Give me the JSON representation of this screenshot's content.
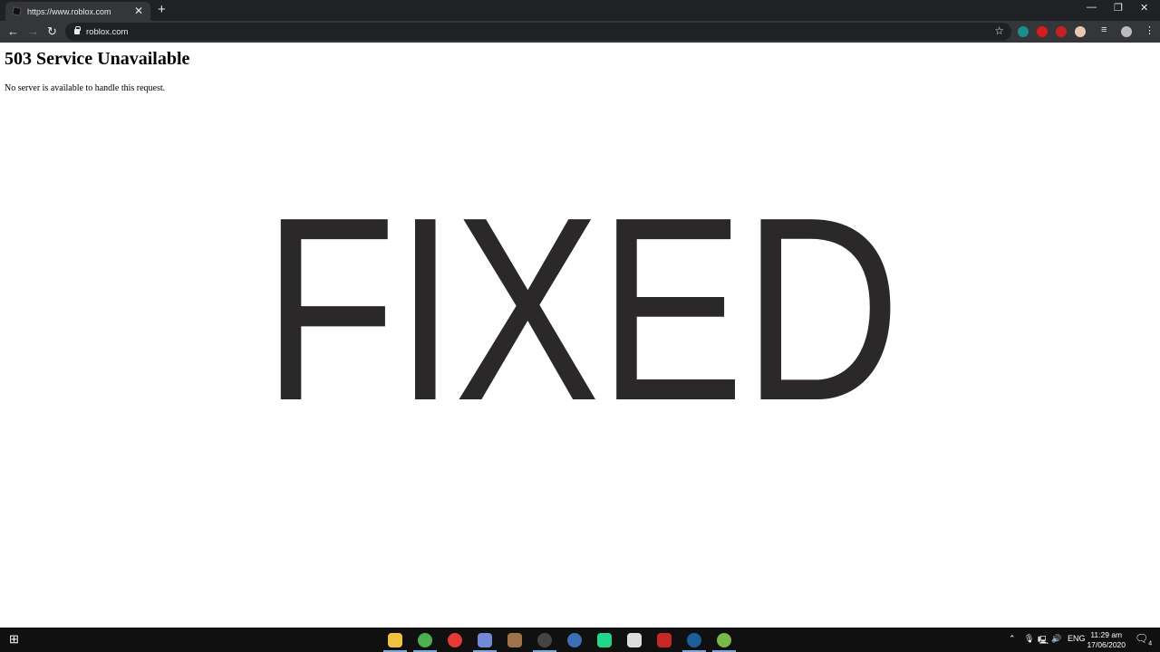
{
  "browser": {
    "tab_title": "https://www.roblox.com",
    "address": "roblox.com",
    "extension_colors": [
      "#1a8f8f",
      "#d81b1b",
      "#c62020",
      "#e8c8b0"
    ]
  },
  "page": {
    "heading": "503 Service Unavailable",
    "message": "No server is available to handle this request.",
    "overlay_text": "FIXED",
    "overlay_color": "#2a2828"
  },
  "taskbar": {
    "apps": [
      {
        "name": "file-explorer",
        "color": "#f0c040"
      },
      {
        "name": "chrome",
        "color": "#4caf50"
      },
      {
        "name": "youtube-music",
        "color": "#e53935"
      },
      {
        "name": "discord",
        "color": "#7289da"
      },
      {
        "name": "game",
        "color": "#a0744a"
      },
      {
        "name": "obs",
        "color": "#444"
      },
      {
        "name": "davinci-resolve",
        "color": "#3b6fb6"
      },
      {
        "name": "pycharm",
        "color": "#21d789"
      },
      {
        "name": "unity",
        "color": "#ddd"
      },
      {
        "name": "garena",
        "color": "#c62828"
      },
      {
        "name": "steam",
        "color": "#1b5e9a"
      },
      {
        "name": "utorrent",
        "color": "#78b94a"
      }
    ],
    "language": "ENG",
    "time": "11:29 am",
    "date": "17/06/2020",
    "notification_count": "4"
  }
}
